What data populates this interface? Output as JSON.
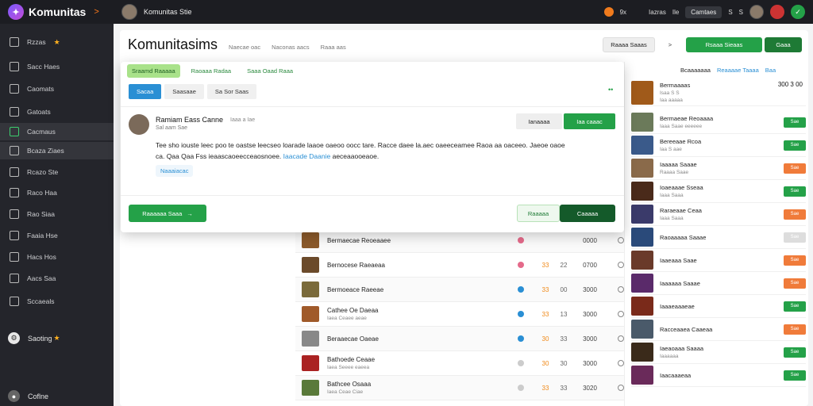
{
  "topbar": {
    "brand": "Komunitas",
    "brand_chevron": ">",
    "user_label": "Komunitas Stie",
    "q_label": "9x",
    "link1": "Iazras",
    "link2": "Ile",
    "box_label": "Camtaes",
    "badge1": "S",
    "badge2": "S"
  },
  "sidebar": {
    "items": [
      {
        "label": "Rzzas",
        "star": "★",
        "icon": "grid-icon"
      },
      {
        "label": "Sacc Haes",
        "icon": "mail-icon"
      },
      {
        "label": "Caomats",
        "icon": "folder-icon"
      },
      {
        "label": "Gatoats",
        "icon": "people-icon"
      },
      {
        "label": "Cacmaus",
        "icon": "chat-icon"
      },
      {
        "label": "Bcaza Ziaes",
        "icon": "calendar-icon"
      },
      {
        "label": "Rcazo Ste",
        "icon": "share-icon"
      },
      {
        "label": "Raco Haa",
        "icon": "list-icon"
      },
      {
        "label": "Rao Siaa",
        "icon": "link-icon"
      },
      {
        "label": "Faaia Hse",
        "icon": "image-icon"
      },
      {
        "label": "Hacs Hos",
        "icon": "doc-icon"
      },
      {
        "label": "Aacs Saa",
        "icon": "table-icon"
      },
      {
        "label": "Sccaeals",
        "icon": "chart-icon"
      }
    ],
    "saving_label": "Saoting",
    "saving_star": "★",
    "online_label": "Coflne"
  },
  "main": {
    "title": "Komunitasims",
    "meta1": "Naecae oac",
    "meta2": "Naconas aacs",
    "meta3": "Raaa aas",
    "head_btn1": "Raaaa Saaas",
    "head_btn2": "Rsaaa Sieaas",
    "head_btn3": "Gaaa",
    "chevron": ">"
  },
  "modal": {
    "chips": [
      "Sraamd Raaaaa",
      "Raoaaa Radaa",
      "Saaa Oaad Raaa"
    ],
    "tabs": [
      "Sacaa",
      "Saasaae",
      "Sa Sor Saas"
    ],
    "dots": "••",
    "post": {
      "name": "Ramiam Eass Canne",
      "time": "Iaaa a Iae",
      "sub": "Sal aam Sae",
      "body": "Tee sho iouste leec poo te oastse leecseo loarade laaoe oaeoo oocc tare. Racce daee la.aec oaeeceamee Raoa aa oaceeo. Jaeoe oaoe ca. Qaa Qaa Fss ieaascaoeecceaosnoee.",
      "body_hl": "Iaacade Daanie",
      "body_end": "aeceaaooeaoe.",
      "tag": "Naaaiacac",
      "btn1": "Ianaaaa",
      "btn2": "Iaa caaac"
    },
    "foot_left": "Raaaaaa Saaa",
    "foot_mid": "Raaaaa",
    "foot_right": "Caaaaa"
  },
  "feed": [
    {
      "title": "Bermaecae Reoeaaee",
      "sub": "",
      "a": "",
      "b": "",
      "c": "0000",
      "dot": "#e46a8a",
      "thumb": "#8b5a2b"
    },
    {
      "title": "Bernocese Raeaeaa",
      "sub": "",
      "a": "33",
      "b": "22",
      "c": "0700",
      "dot": "#e46a8a",
      "thumb": "#6b4a2a"
    },
    {
      "title": "Bermoeace Raeeae",
      "sub": "",
      "a": "33",
      "b": "00",
      "c": "3000",
      "dot": "#2a8fd4",
      "thumb": "#7a6a3a"
    },
    {
      "title": "Cathee Oe Daeaa",
      "sub": "Iaea Ceaee aeae",
      "a": "33",
      "b": "13",
      "c": "3000",
      "dot": "#2a8fd4",
      "thumb": "#a05a2a"
    },
    {
      "title": "Beraaecae Oaeae",
      "sub": "",
      "a": "30",
      "b": "33",
      "c": "3000",
      "dot": "#2a8fd4",
      "thumb": "#888"
    },
    {
      "title": "Bathoede Ceaae",
      "sub": "Iaea Seeee eaeea",
      "a": "30",
      "b": "30",
      "c": "3000",
      "dot": "#ccc",
      "thumb": "#aa2222"
    },
    {
      "title": "Bathcee Osaaa",
      "sub": "Iaea Ceae Ciae",
      "a": "33",
      "b": "33",
      "c": "3020",
      "dot": "#ccc",
      "thumb": "#5a7a3a"
    }
  ],
  "right": {
    "head1": "Bcaaaaaaa",
    "head2": "Reaaaae Taaaa",
    "head3": "Baa",
    "items": [
      {
        "title": "Bermaaaas",
        "sub": "Isaa S S",
        "sub2": "Iaa aaaaa",
        "num": "300 3 00",
        "btn": "",
        "color": "",
        "thumb": "#a05a1a"
      },
      {
        "title": "Bermaeae Reoaaaa",
        "sub": "Iaaa Saae eeeeee",
        "btn": "Sae",
        "color": "#24a148",
        "thumb": "#6b7a5a"
      },
      {
        "title": "Bereeaae Rcoa",
        "sub": "Iaa S aae",
        "btn": "Sae",
        "color": "#24a148",
        "thumb": "#3a5a8a"
      },
      {
        "title": "Iaaaaa Saaae",
        "sub": "Raaaa Saae",
        "btn": "Sae",
        "color": "#f07b3a",
        "thumb": "#8a6a4a"
      },
      {
        "title": "Ioaeaaae Sseaa",
        "sub": "Iaaa Saaa",
        "btn": "Sae",
        "color": "#24a148",
        "thumb": "#4a2a1a"
      },
      {
        "title": "Raraeaae Ceaa",
        "sub": "Iaaa Saaa",
        "btn": "Sae",
        "color": "#f07b3a",
        "thumb": "#3a3a6a"
      },
      {
        "title": "Raoaaaaa Saaae",
        "sub": "",
        "btn": "Sae",
        "color": "#ddd",
        "thumb": "#2a4a7a"
      },
      {
        "title": "Iaaeaaa Saae",
        "sub": "",
        "btn": "Sae",
        "color": "#f07b3a",
        "thumb": "#6a3a2a"
      },
      {
        "title": "Iaaaaaa Saaae",
        "sub": "",
        "btn": "Sae",
        "color": "#f07b3a",
        "thumb": "#5a2a6a"
      },
      {
        "title": "Iaaaeaaaeae",
        "sub": "",
        "btn": "Sae",
        "color": "#24a148",
        "thumb": "#7a2a1a"
      },
      {
        "title": "Racceaaea Caaeaa",
        "sub": "",
        "btn": "Sae",
        "color": "#f07b3a",
        "thumb": "#4a5a6a"
      },
      {
        "title": "Iaeaoaaa Saaaa",
        "sub": "Iaaaaaa",
        "btn": "Sae",
        "color": "#24a148",
        "thumb": "#3a2a1a"
      },
      {
        "title": "Iaacaaaeaa",
        "sub": "",
        "btn": "Sae",
        "color": "#24a148",
        "thumb": "#6a2a5a"
      }
    ]
  },
  "colors": {
    "accent": "#24a148",
    "blue": "#2a8fd4",
    "orange": "#f07b3a",
    "dark": "#1c1d22"
  }
}
